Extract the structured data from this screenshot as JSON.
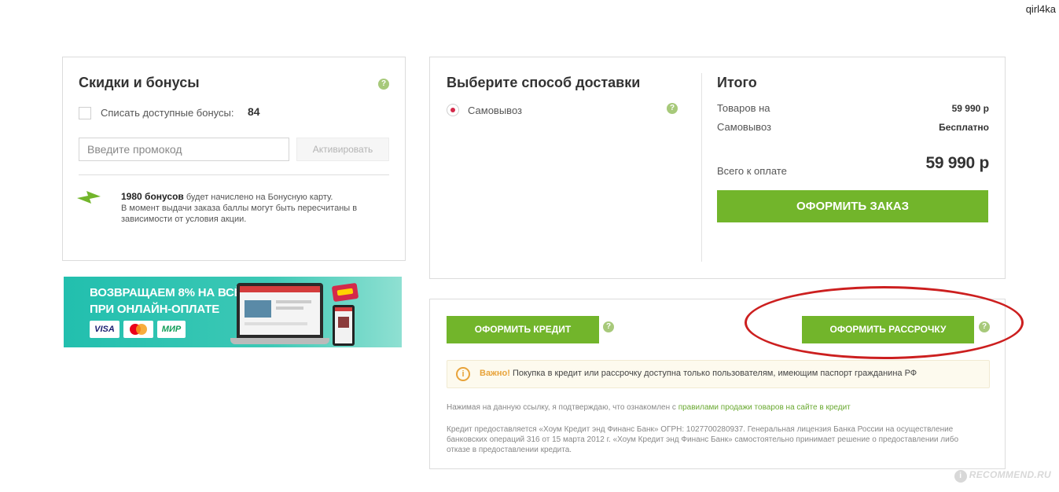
{
  "user": {
    "name": "qirl4ka"
  },
  "discounts": {
    "title": "Скидки и бонусы",
    "help_icon": "?",
    "bonus_checkbox_label": "Списать доступные бонусы:",
    "bonus_available": "84",
    "promo_placeholder": "Введите промокод",
    "activate_label": "Активировать",
    "bonus_count": "1980 бонусов",
    "bonus_text": " будет начислено на Бонусную карту.",
    "bonus_note": "В момент выдачи заказа баллы могут быть пересчитаны в зависимости от условия акции."
  },
  "banner": {
    "line1": "ВОЗВРАЩАЕМ 8% НА ВСЁ",
    "line2": "ПРИ ОНЛАЙН-ОПЛАТЕ",
    "cards": [
      "VISA",
      "MasterCard",
      "МИР"
    ]
  },
  "delivery": {
    "title": "Выберите способ доставки",
    "options": [
      {
        "label": "Самовывоз",
        "selected": true
      }
    ],
    "help_icon": "?"
  },
  "total": {
    "title": "Итого",
    "rows": [
      {
        "label": "Товаров на",
        "value": "59 990 р"
      },
      {
        "label": "Самовывоз",
        "value": "Бесплатно"
      }
    ],
    "grand_label": "Всего к оплате",
    "grand_value": "59 990 р",
    "order_button": "ОФОРМИТЬ ЗАКАЗ"
  },
  "credit": {
    "credit_button": "ОФОРМИТЬ КРЕДИТ",
    "installment_button": "ОФОРМИТЬ РАССРОЧКУ",
    "help_icon": "?",
    "warning_icon": "i",
    "warning_label": "Важно!",
    "warning_text": " Покупка в кредит или рассрочку доступна только пользователям, имеющим паспорт гражданина РФ",
    "agree_text": "Нажимая на данную ссылку, я подтверждаю, что ознакомлен с ",
    "agree_link": "правилами продажи товаров на сайте в кредит",
    "legal_text": "Кредит предоставляется «Хоум Кредит энд Финанс Банк» ОГРН: 1027700280937. Генеральная лицензия Банка России на осуществление банковских операций    316 от 15 марта 2012 г. «Хоум Кредит энд Финанс Банк» самостоятельно принимает решение о предоставлении либо отказе в предоставлении кредита."
  },
  "watermark": {
    "text": "RECOMMEND.RU",
    "icon": "i"
  },
  "colors": {
    "accent_green": "#72b52b",
    "help_green": "#a7c97a",
    "annotation_red": "#cc1f1f",
    "warning_orange": "#e8a33a"
  }
}
